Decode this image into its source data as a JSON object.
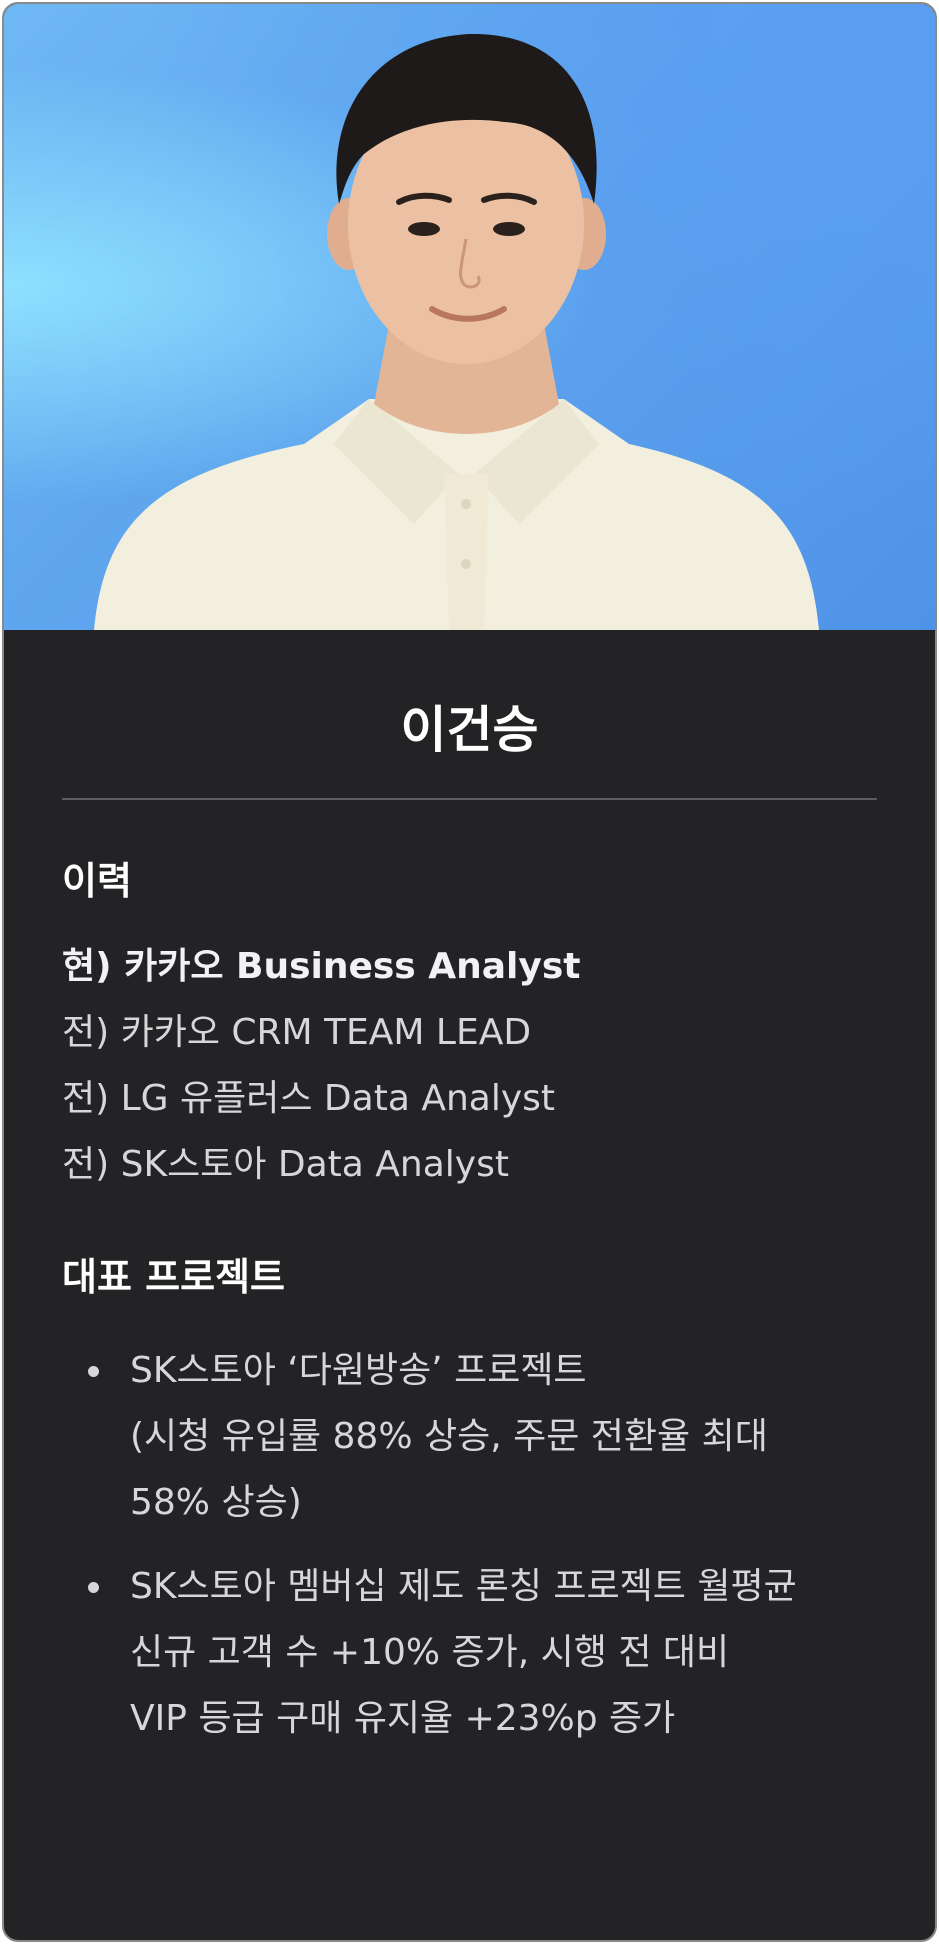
{
  "profile": {
    "name": "이건승",
    "photo_icon": "portrait-photo"
  },
  "history": {
    "title": "이력",
    "items": [
      {
        "text": "현) 카카오 Business Analyst",
        "current": true
      },
      {
        "text": "전) 카카오 CRM TEAM LEAD",
        "current": false
      },
      {
        "text": "전) LG 유플러스 Data Analyst",
        "current": false
      },
      {
        "text": "전) SK스토아 Data Analyst",
        "current": false
      }
    ]
  },
  "projects": {
    "title": "대표 프로젝트",
    "items": [
      {
        "lines": [
          "SK스토아 ‘다원방송’ 프로젝트",
          "(시청 유입률 88% 상승, 주문 전환율 최대",
          "58% 상승)"
        ]
      },
      {
        "lines": [
          "SK스토아 멤버십 제도 론칭 프로젝트 월평균",
          "신규 고객 수 +10% 증가, 시행 전 대비",
          "VIP 등급 구매 유지율 +23%p 증가"
        ]
      }
    ]
  },
  "colors": {
    "card_background": "#232325",
    "photo_background": "#5fa6ee",
    "text_primary": "#ffffff",
    "text_secondary": "#d7d7d9"
  }
}
